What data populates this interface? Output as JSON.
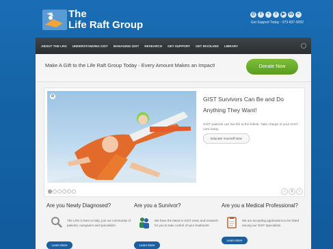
{
  "header": {
    "org_line1": "The",
    "org_line2": "Life Raft Group",
    "support_text": "Get Support Today - 973-837-9092",
    "social_icons": [
      "email-icon",
      "facebook-icon",
      "flickr-icon",
      "twitter-icon",
      "youtube-icon",
      "linkedin-icon",
      "rss-icon"
    ]
  },
  "nav": {
    "items": [
      "ABOUT THE LRG",
      "UNDERSTANDING GIST",
      "MANAGING GIST",
      "RESEARCH",
      "GET SUPPORT",
      "GET INVOLVED",
      "LIBRARY"
    ]
  },
  "banner": {
    "text": "Make A Gift to the Life Raft Group Today - Every Amount Makes an Impact!",
    "donate_label": "Donate Now"
  },
  "slider": {
    "title": "GIST Survivors Can Be and Do Anything They Want!",
    "text": "GIST patients can live life to the fullest. Take charge of your GIST care today.",
    "cta_label": "Educate Yourself Now",
    "slide_count": 6
  },
  "columns": [
    {
      "heading": "Are you Newly Diagnosed?",
      "text": "The LRG is here to help, join our community of patients, caregivers and specialists!",
      "button": "Learn More",
      "icon": "magnifier-icon"
    },
    {
      "heading": "Are you a Survivor?",
      "text": "We have the latest in GIST news and research for you to take control of your treatment!",
      "button": "Learn More",
      "icon": "people-icon"
    },
    {
      "heading": "Are you a Medical Professional?",
      "text": "We are accepting applications to be listed among our GIST Specialists.",
      "button": "Learn More",
      "icon": "clipboard-icon"
    }
  ],
  "colors": {
    "brand_blue": "#1463a6",
    "donate_green": "#6aae2c",
    "nav_dark": "#33383b",
    "button_blue": "#1d5e9e"
  }
}
